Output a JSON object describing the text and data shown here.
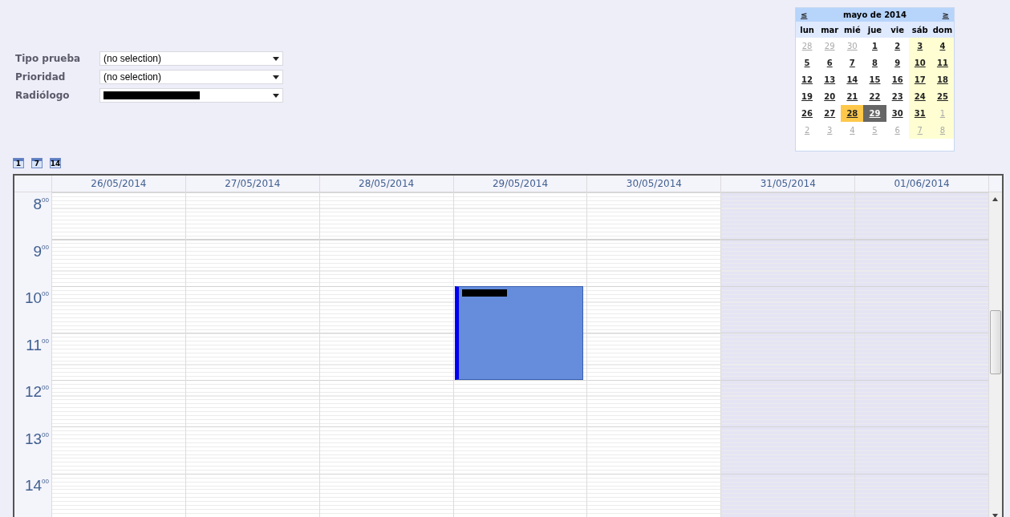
{
  "filters": [
    {
      "label": "Tipo prueba",
      "value": "(no selection)",
      "redacted": false
    },
    {
      "label": "Prioridad",
      "value": "(no selection)",
      "redacted": false
    },
    {
      "label": "Radiólogo",
      "redacted": true
    }
  ],
  "mini_calendar": {
    "prev": "≤",
    "title": "mayo de 2014",
    "next": "≥",
    "weekdays": [
      "lun",
      "mar",
      "mié",
      "jue",
      "vie",
      "sáb",
      "dom"
    ],
    "weeks": [
      [
        {
          "day": "28",
          "other_month": true,
          "today": false,
          "selected": false
        },
        {
          "day": "29",
          "other_month": true,
          "today": false,
          "selected": false
        },
        {
          "day": "30",
          "other_month": true,
          "today": false,
          "selected": false
        },
        {
          "day": "1",
          "other_month": false,
          "today": false,
          "selected": false
        },
        {
          "day": "2",
          "other_month": false,
          "today": false,
          "selected": false
        },
        {
          "day": "3",
          "other_month": false,
          "today": false,
          "selected": false
        },
        {
          "day": "4",
          "other_month": false,
          "today": false,
          "selected": false
        }
      ],
      [
        {
          "day": "5",
          "other_month": false,
          "today": false,
          "selected": false
        },
        {
          "day": "6",
          "other_month": false,
          "today": false,
          "selected": false
        },
        {
          "day": "7",
          "other_month": false,
          "today": false,
          "selected": false
        },
        {
          "day": "8",
          "other_month": false,
          "today": false,
          "selected": false
        },
        {
          "day": "9",
          "other_month": false,
          "today": false,
          "selected": false
        },
        {
          "day": "10",
          "other_month": false,
          "today": false,
          "selected": false
        },
        {
          "day": "11",
          "other_month": false,
          "today": false,
          "selected": false
        }
      ],
      [
        {
          "day": "12",
          "other_month": false,
          "today": false,
          "selected": false
        },
        {
          "day": "13",
          "other_month": false,
          "today": false,
          "selected": false
        },
        {
          "day": "14",
          "other_month": false,
          "today": false,
          "selected": false
        },
        {
          "day": "15",
          "other_month": false,
          "today": false,
          "selected": false
        },
        {
          "day": "16",
          "other_month": false,
          "today": false,
          "selected": false
        },
        {
          "day": "17",
          "other_month": false,
          "today": false,
          "selected": false
        },
        {
          "day": "18",
          "other_month": false,
          "today": false,
          "selected": false
        }
      ],
      [
        {
          "day": "19",
          "other_month": false,
          "today": false,
          "selected": false
        },
        {
          "day": "20",
          "other_month": false,
          "today": false,
          "selected": false
        },
        {
          "day": "21",
          "other_month": false,
          "today": false,
          "selected": false
        },
        {
          "day": "22",
          "other_month": false,
          "today": false,
          "selected": false
        },
        {
          "day": "23",
          "other_month": false,
          "today": false,
          "selected": false
        },
        {
          "day": "24",
          "other_month": false,
          "today": false,
          "selected": false
        },
        {
          "day": "25",
          "other_month": false,
          "today": false,
          "selected": false
        }
      ],
      [
        {
          "day": "26",
          "other_month": false,
          "today": false,
          "selected": false
        },
        {
          "day": "27",
          "other_month": false,
          "today": false,
          "selected": false
        },
        {
          "day": "28",
          "other_month": false,
          "today": true,
          "selected": false
        },
        {
          "day": "29",
          "other_month": false,
          "today": false,
          "selected": true
        },
        {
          "day": "30",
          "other_month": false,
          "today": false,
          "selected": false
        },
        {
          "day": "31",
          "other_month": false,
          "today": false,
          "selected": false
        },
        {
          "day": "1",
          "other_month": true,
          "today": false,
          "selected": false
        }
      ],
      [
        {
          "day": "2",
          "other_month": true,
          "today": false,
          "selected": false
        },
        {
          "day": "3",
          "other_month": true,
          "today": false,
          "selected": false
        },
        {
          "day": "4",
          "other_month": true,
          "today": false,
          "selected": false
        },
        {
          "day": "5",
          "other_month": true,
          "today": false,
          "selected": false
        },
        {
          "day": "6",
          "other_month": true,
          "today": false,
          "selected": false
        },
        {
          "day": "7",
          "other_month": true,
          "today": false,
          "selected": false
        },
        {
          "day": "8",
          "other_month": true,
          "today": false,
          "selected": false
        }
      ]
    ]
  },
  "view_buttons": [
    {
      "label": "1"
    },
    {
      "label": "7"
    },
    {
      "label": "14"
    }
  ],
  "schedule": {
    "days": [
      {
        "label": "26/05/2014",
        "weekend": false
      },
      {
        "label": "27/05/2014",
        "weekend": false
      },
      {
        "label": "28/05/2014",
        "weekend": false
      },
      {
        "label": "29/05/2014",
        "weekend": false,
        "events": [
          {
            "kind": "appointment"
          }
        ]
      },
      {
        "label": "30/05/2014",
        "weekend": false
      },
      {
        "label": "31/05/2014",
        "weekend": true
      },
      {
        "label": "01/06/2014",
        "weekend": true
      }
    ],
    "hours": [
      "8$^{00}$",
      "9$^{00}$",
      "10$^{00}$",
      "11$^{00}$",
      "12$^{00}$",
      "13$^{00}$",
      "14$^{00}$"
    ]
  }
}
